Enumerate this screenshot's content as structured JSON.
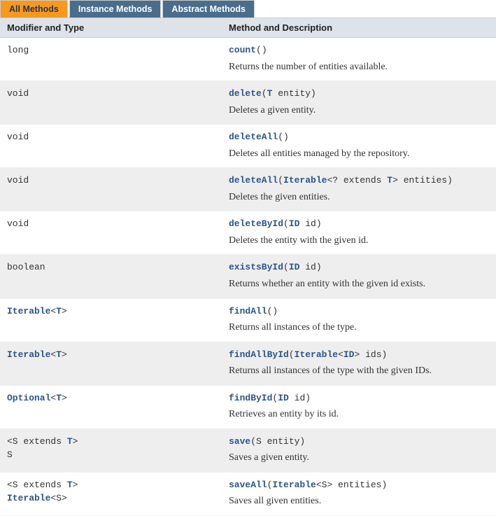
{
  "tabs": [
    {
      "label": "All Methods",
      "active": true
    },
    {
      "label": "Instance Methods",
      "active": false
    },
    {
      "label": "Abstract Methods",
      "active": false
    }
  ],
  "headers": {
    "modifier": "Modifier and Type",
    "method": "Method and Description"
  },
  "methods": [
    {
      "modifier_plain": "long",
      "modifier_links": [],
      "name": "count",
      "params_html": "()",
      "desc": "Returns the number of entities available."
    },
    {
      "modifier_plain": "void",
      "modifier_links": [],
      "name": "delete",
      "params_html": "(<span class=\"ptype\">T</span> entity)",
      "desc": "Deletes a given entity."
    },
    {
      "modifier_plain": "void",
      "modifier_links": [],
      "name": "deleteAll",
      "params_html": "()",
      "desc": "Deletes all entities managed by the repository."
    },
    {
      "modifier_plain": "void",
      "modifier_links": [],
      "name": "deleteAll",
      "params_html": "(<span class=\"ptype\">Iterable</span>&lt;? extends <span class=\"ptype\">T</span>&gt; entities)",
      "desc": "Deletes the given entities."
    },
    {
      "modifier_plain": "void",
      "modifier_links": [],
      "name": "deleteById",
      "params_html": "(<span class=\"ptype\">ID</span> id)",
      "desc": "Deletes the entity with the given id."
    },
    {
      "modifier_plain": "boolean",
      "modifier_links": [],
      "name": "existsById",
      "params_html": "(<span class=\"ptype\">ID</span> id)",
      "desc": "Returns whether an entity with the given id exists."
    },
    {
      "modifier_plain": "",
      "modifier_html": "<span class=\"link\">Iterable</span>&lt;<span class=\"link\">T</span>&gt;",
      "name": "findAll",
      "params_html": "()",
      "desc": "Returns all instances of the type."
    },
    {
      "modifier_plain": "",
      "modifier_html": "<span class=\"link\">Iterable</span>&lt;<span class=\"link\">T</span>&gt;",
      "name": "findAllById",
      "params_html": "(<span class=\"ptype\">Iterable</span>&lt;<span class=\"ptype\">ID</span>&gt; ids)",
      "desc": "Returns all instances of the type with the given IDs."
    },
    {
      "modifier_plain": "",
      "modifier_html": "<span class=\"link\">Optional</span>&lt;<span class=\"link\">T</span>&gt;",
      "name": "findById",
      "params_html": "(<span class=\"ptype\">ID</span> id)",
      "desc": "Retrieves an entity by its id."
    },
    {
      "modifier_plain": "",
      "modifier_html": "&lt;S extends <span class=\"link\">T</span>&gt;<br>S",
      "name": "save",
      "params_html": "(S entity)",
      "desc": "Saves a given entity."
    },
    {
      "modifier_plain": "",
      "modifier_html": "&lt;S extends <span class=\"link\">T</span>&gt;<br><span class=\"link\">Iterable</span>&lt;S&gt;",
      "name": "saveAll",
      "params_html": "(<span class=\"ptype\">Iterable</span>&lt;S&gt; entities)",
      "desc": "Saves all given entities."
    }
  ]
}
